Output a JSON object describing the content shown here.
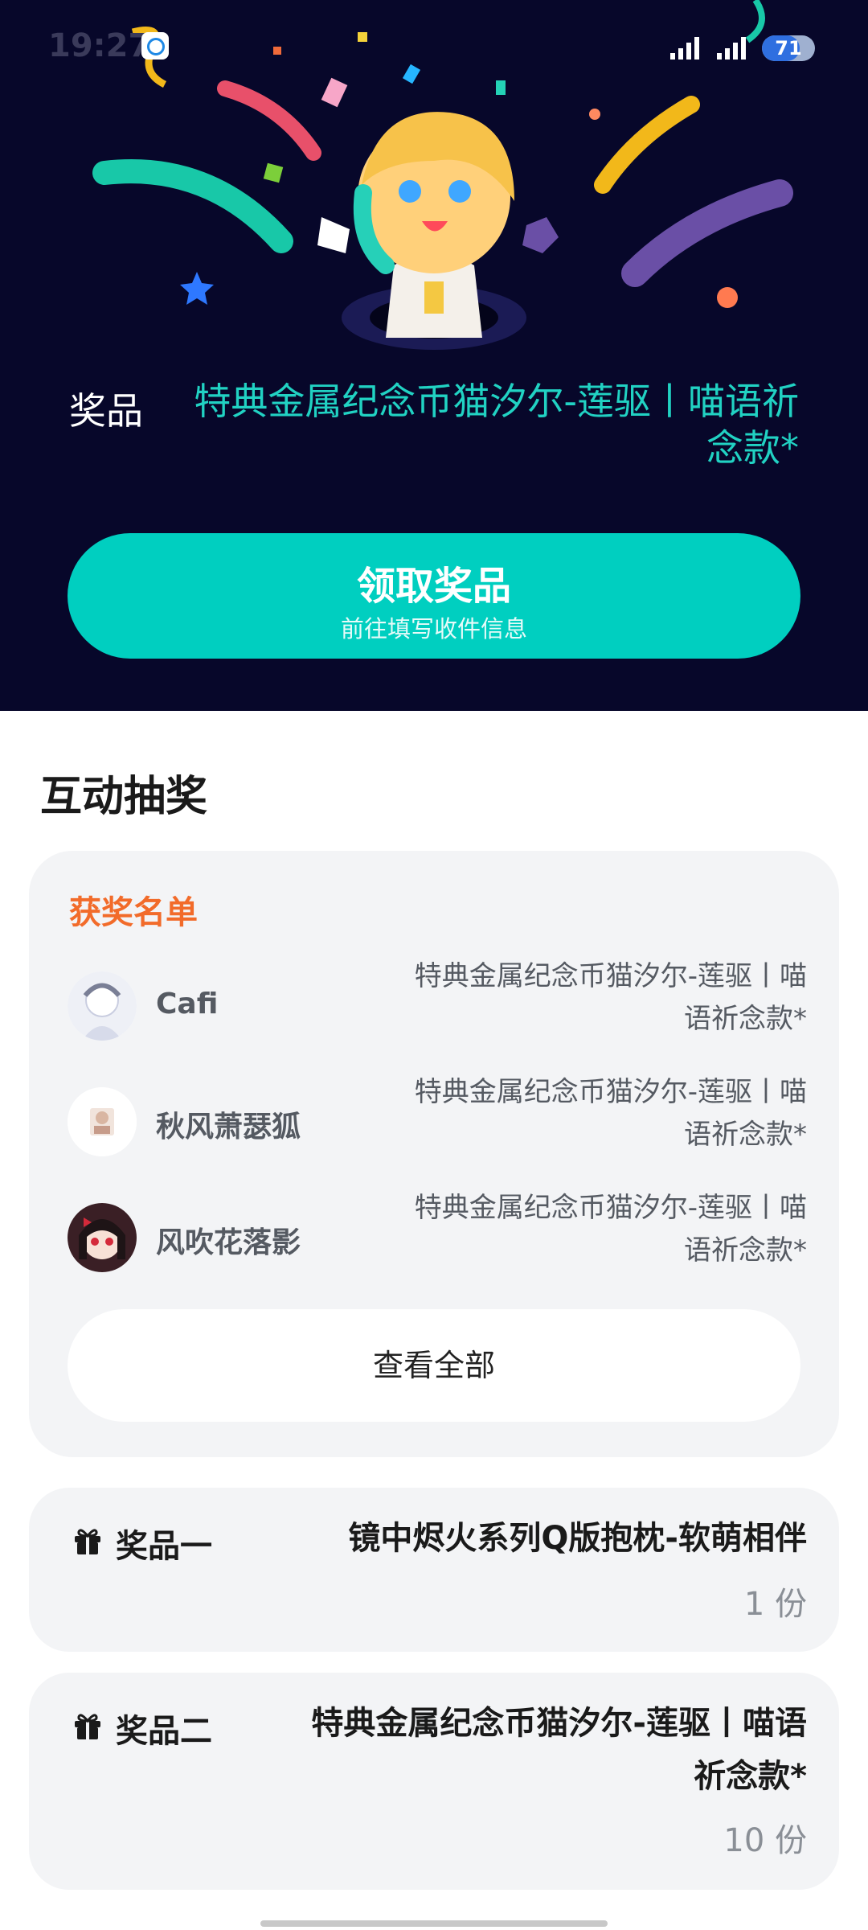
{
  "status_bar": {
    "time": "19:27",
    "battery": "71",
    "battery_level": 0.71
  },
  "hero": {
    "prize_label": "奖品",
    "prize_name": "特典金属纪念币猫汐尔-莲驱丨喵语祈念款*",
    "claim_button": {
      "title": "领取奖品",
      "subtitle": "前往填写收件信息"
    }
  },
  "section": {
    "title": "互动抽奖"
  },
  "winners": {
    "title": "获奖名单",
    "items": [
      {
        "name": "Cafi",
        "prize": "特典金属纪念币猫汐尔-莲驱丨喵语祈念款*"
      },
      {
        "name": "秋风萧瑟狐",
        "prize": "特典金属纪念币猫汐尔-莲驱丨喵语祈念款*"
      },
      {
        "name": "风吹花落影",
        "prize": "特典金属纪念币猫汐尔-莲驱丨喵语祈念款*"
      }
    ],
    "view_all_label": "查看全部"
  },
  "prizes": [
    {
      "label": "奖品一",
      "name": "镜中烬火系列Q版抱枕-软萌相伴",
      "quantity": "1 份"
    },
    {
      "label": "奖品二",
      "name": "特典金属纪念币猫汐尔-莲驱丨喵语祈念款*",
      "quantity": "10 份"
    }
  ],
  "colors": {
    "hero_background": "#07072a",
    "accent_teal": "#00cfc0",
    "winners_title": "#f26b2a",
    "card_background": "#f3f4f6"
  },
  "icons": {
    "gift": "gift-icon",
    "signal": "signal-icon",
    "battery": "battery-icon"
  }
}
